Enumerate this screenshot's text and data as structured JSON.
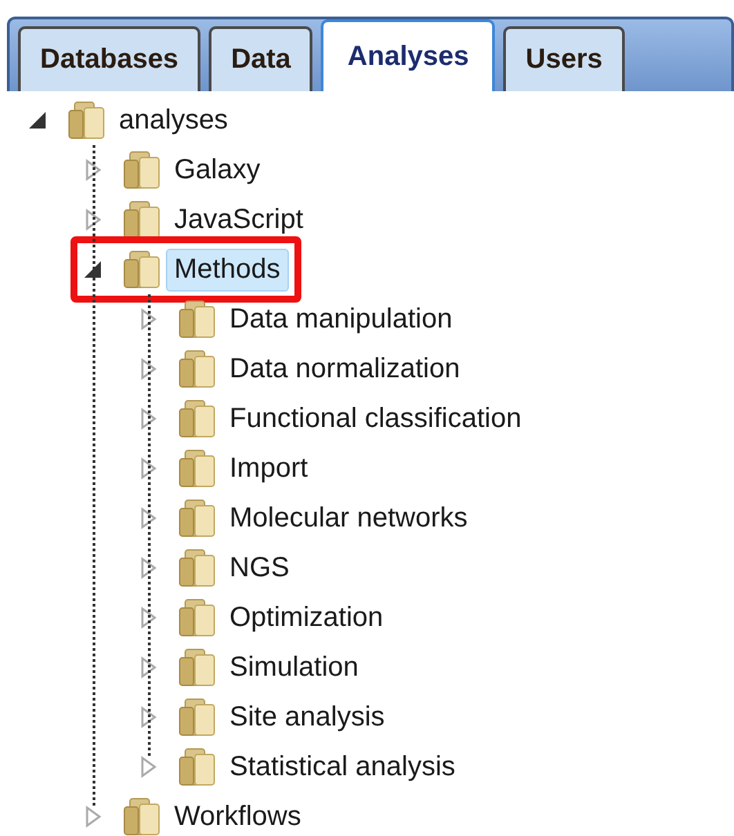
{
  "tabs": [
    {
      "label": "Databases",
      "selected": false
    },
    {
      "label": "Data",
      "selected": false
    },
    {
      "label": "Analyses",
      "selected": true
    },
    {
      "label": "Users",
      "selected": false
    }
  ],
  "tree": {
    "label": "analyses",
    "expanded": true,
    "selected": false,
    "marked": false,
    "children": [
      {
        "label": "Galaxy",
        "expanded": false,
        "selected": false,
        "marked": false
      },
      {
        "label": "JavaScript",
        "expanded": false,
        "selected": false,
        "marked": false
      },
      {
        "label": "Methods",
        "expanded": true,
        "selected": true,
        "marked": true,
        "children": [
          {
            "label": "Data manipulation",
            "expanded": false,
            "selected": false,
            "marked": false
          },
          {
            "label": "Data normalization",
            "expanded": false,
            "selected": false,
            "marked": false
          },
          {
            "label": "Functional classification",
            "expanded": false,
            "selected": false,
            "marked": false
          },
          {
            "label": "Import",
            "expanded": false,
            "selected": false,
            "marked": false
          },
          {
            "label": "Molecular networks",
            "expanded": false,
            "selected": false,
            "marked": false
          },
          {
            "label": "NGS",
            "expanded": false,
            "selected": false,
            "marked": false
          },
          {
            "label": "Optimization",
            "expanded": false,
            "selected": false,
            "marked": false
          },
          {
            "label": "Simulation",
            "expanded": false,
            "selected": false,
            "marked": false
          },
          {
            "label": "Site analysis",
            "expanded": false,
            "selected": false,
            "marked": false
          },
          {
            "label": "Statistical analysis",
            "expanded": false,
            "selected": false,
            "marked": false
          }
        ]
      },
      {
        "label": "Workflows",
        "expanded": false,
        "selected": false,
        "marked": false
      }
    ]
  }
}
